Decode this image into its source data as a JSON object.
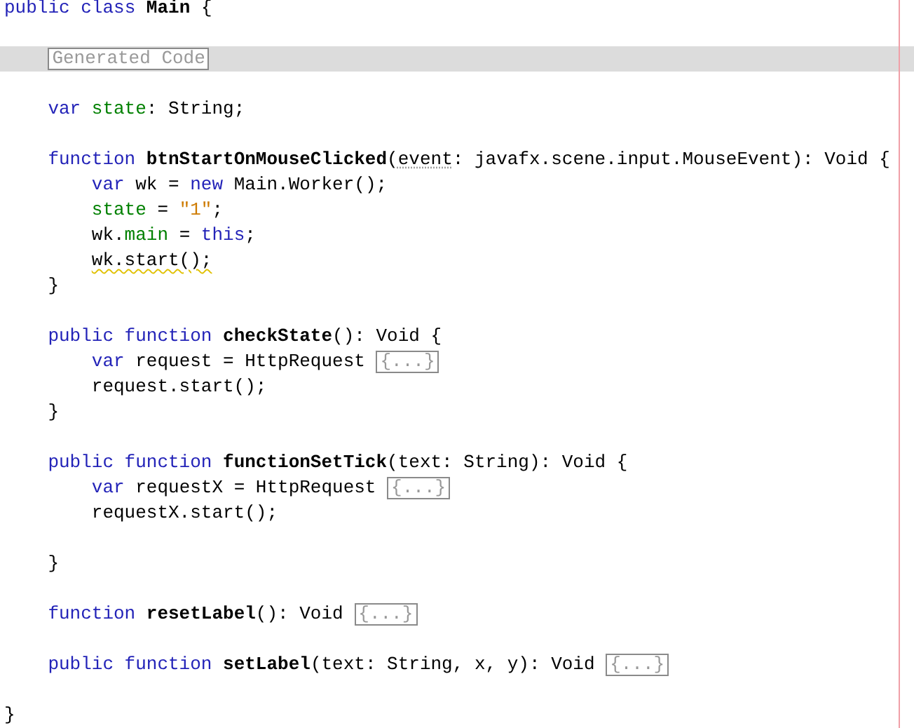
{
  "editor": {
    "lines": [
      {
        "kind": "code",
        "tokens": [
          {
            "kind": "keyword",
            "text": "public class "
          },
          {
            "kind": "name",
            "text": "Main"
          },
          {
            "kind": "plain",
            "text": " {"
          }
        ],
        "children": [
          {
            "kind": "blank"
          },
          {
            "kind": "fold",
            "text": "Generated Code"
          },
          {
            "kind": "blank"
          },
          {
            "kind": "code",
            "tokens": [
              {
                "kind": "keyword",
                "text": "var "
              },
              {
                "kind": "field",
                "text": "state"
              },
              {
                "kind": "plain",
                "text": ": String;"
              }
            ]
          },
          {
            "kind": "blank"
          },
          {
            "kind": "code",
            "tokens": [
              {
                "kind": "keyword",
                "text": "function "
              },
              {
                "kind": "name",
                "text": "btnStartOnMouseClicked"
              },
              {
                "kind": "plain",
                "text": "("
              },
              {
                "kind": "plain",
                "text": "event",
                "unused": true
              },
              {
                "kind": "plain",
                "text": ": javafx.scene.input.MouseEvent): Void {"
              }
            ],
            "children": [
              {
                "kind": "code",
                "tokens": [
                  {
                    "kind": "keyword",
                    "text": "var "
                  },
                  {
                    "kind": "plain",
                    "text": "wk = "
                  },
                  {
                    "kind": "keyword",
                    "text": "new "
                  },
                  {
                    "kind": "plain",
                    "text": "Main.Worker();"
                  }
                ]
              },
              {
                "kind": "code",
                "tokens": [
                  {
                    "kind": "field",
                    "text": "state"
                  },
                  {
                    "kind": "plain",
                    "text": " = "
                  },
                  {
                    "kind": "string",
                    "text": "\"1\""
                  },
                  {
                    "kind": "plain",
                    "text": ";"
                  }
                ]
              },
              {
                "kind": "code",
                "tokens": [
                  {
                    "kind": "plain",
                    "text": "wk."
                  },
                  {
                    "kind": "field",
                    "text": "main"
                  },
                  {
                    "kind": "plain",
                    "text": " = "
                  },
                  {
                    "kind": "keyword",
                    "text": "this"
                  },
                  {
                    "kind": "plain",
                    "text": ";"
                  }
                ]
              },
              {
                "kind": "code",
                "tokens": [
                  {
                    "kind": "plain",
                    "text": "wk.start();",
                    "warning": true
                  }
                ]
              }
            ]
          },
          {
            "kind": "code",
            "tokens": [
              {
                "kind": "plain",
                "text": "}"
              }
            ]
          },
          {
            "kind": "blank"
          },
          {
            "kind": "code",
            "tokens": [
              {
                "kind": "keyword",
                "text": "public function "
              },
              {
                "kind": "name",
                "text": "checkState"
              },
              {
                "kind": "plain",
                "text": "(): Void {"
              }
            ],
            "children": [
              {
                "kind": "code",
                "tokens": [
                  {
                    "kind": "keyword",
                    "text": "var "
                  },
                  {
                    "kind": "plain",
                    "text": "request = HttpRequest "
                  },
                  {
                    "kind": "fold",
                    "text": "{...}"
                  }
                ]
              },
              {
                "kind": "code",
                "tokens": [
                  {
                    "kind": "plain",
                    "text": "request.start();"
                  }
                ]
              }
            ]
          },
          {
            "kind": "code",
            "tokens": [
              {
                "kind": "plain",
                "text": "}"
              }
            ]
          },
          {
            "kind": "blank"
          },
          {
            "kind": "code",
            "tokens": [
              {
                "kind": "keyword",
                "text": "public function "
              },
              {
                "kind": "name",
                "text": "functionSetTick"
              },
              {
                "kind": "plain",
                "text": "(text: String): Void {"
              }
            ],
            "children": [
              {
                "kind": "code",
                "tokens": [
                  {
                    "kind": "keyword",
                    "text": "var "
                  },
                  {
                    "kind": "plain",
                    "text": "requestX = HttpRequest "
                  },
                  {
                    "kind": "fold",
                    "text": "{...}"
                  }
                ]
              },
              {
                "kind": "code",
                "tokens": [
                  {
                    "kind": "plain",
                    "text": "requestX.start();"
                  }
                ]
              },
              {
                "kind": "blank"
              }
            ]
          },
          {
            "kind": "code",
            "tokens": [
              {
                "kind": "plain",
                "text": "}"
              }
            ]
          },
          {
            "kind": "blank"
          },
          {
            "kind": "code",
            "tokens": [
              {
                "kind": "keyword",
                "text": "function "
              },
              {
                "kind": "name",
                "text": "resetLabel"
              },
              {
                "kind": "plain",
                "text": "(): Void "
              },
              {
                "kind": "fold",
                "text": "{...}"
              }
            ]
          },
          {
            "kind": "blank"
          },
          {
            "kind": "code",
            "tokens": [
              {
                "kind": "keyword",
                "text": "public function "
              },
              {
                "kind": "name",
                "text": "setLabel"
              },
              {
                "kind": "plain",
                "text": "(text: String, x, y): Void "
              },
              {
                "kind": "fold",
                "text": "{...}"
              }
            ]
          },
          {
            "kind": "blank"
          }
        ]
      },
      {
        "kind": "code",
        "tokens": [
          {
            "kind": "plain",
            "text": "}"
          }
        ]
      }
    ]
  }
}
